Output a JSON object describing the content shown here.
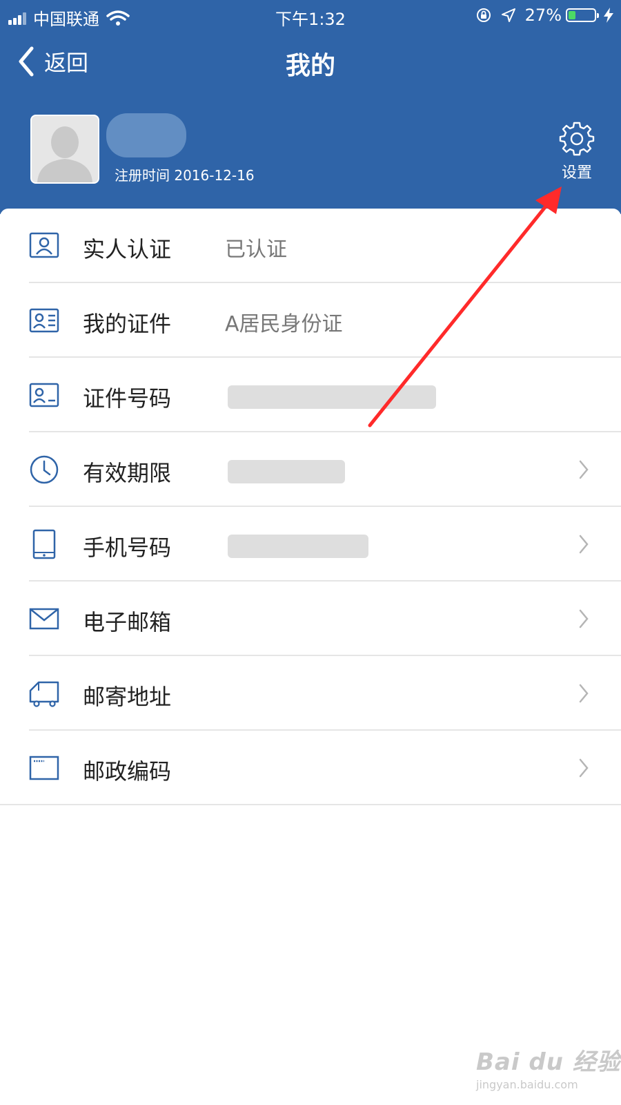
{
  "status_bar": {
    "carrier": "中国联通",
    "time": "下午1:32",
    "battery": "27%",
    "battery_fraction": 0.27
  },
  "nav": {
    "back_label": "返回",
    "title": "我的"
  },
  "profile": {
    "registration": "注册时间 2016-12-16",
    "settings_label": "设置"
  },
  "rows": [
    {
      "label": "实人认证",
      "value": "已认证",
      "icon": "person-card-icon"
    },
    {
      "label": "我的证件",
      "value": "A居民身份证",
      "icon": "id-card-icon"
    },
    {
      "label": "证件号码",
      "value": "",
      "icon": "id-number-icon"
    },
    {
      "label": "有效期限",
      "value": "",
      "icon": "clock-icon"
    },
    {
      "label": "手机号码",
      "value": "",
      "icon": "phone-icon"
    },
    {
      "label": "电子邮箱",
      "value": "",
      "icon": "mail-icon"
    },
    {
      "label": "邮寄地址",
      "value": "",
      "icon": "truck-icon"
    },
    {
      "label": "邮政编码",
      "value": "",
      "icon": "postcode-icon"
    }
  ],
  "watermark": {
    "main": "Bai du 经验",
    "sub": "jingyan.baidu.com"
  },
  "colors": {
    "header_blue": "#2f64a8",
    "icon_blue": "#2f64a8",
    "annotation_red": "#ff2a2a"
  }
}
